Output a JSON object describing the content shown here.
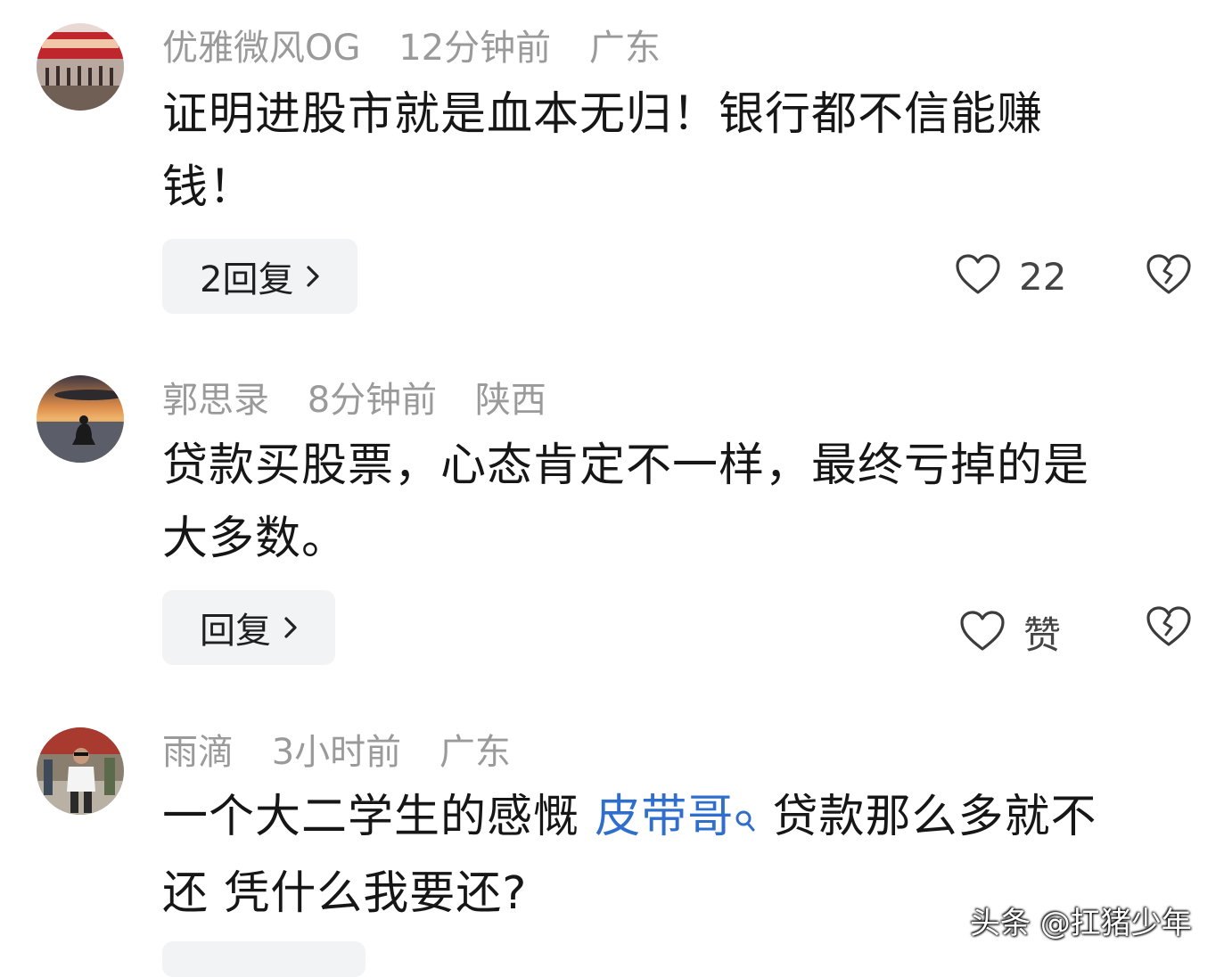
{
  "comments": [
    {
      "user": "优雅微风OG",
      "time": "12分钟前",
      "location": "广东",
      "text_line1": "证明进股市就是血本无归！银行都不信能赚",
      "text_line2": "钱！",
      "reply_label": "2回复",
      "like_count": "22"
    },
    {
      "user": "郭思录",
      "time": "8分钟前",
      "location": "陕西",
      "text_line1": "贷款买股票，心态肯定不一样，最终亏掉的是",
      "text_line2": "大多数。",
      "reply_label": "回复",
      "like_count": "赞"
    },
    {
      "user": "雨滴",
      "time": "3小时前",
      "location": "广东",
      "text_before": "一个大二学生的感慨 ",
      "mention": "皮带哥",
      "text_after": " 贷款那么多就不",
      "text_line2": "还 凭什么我要还?"
    }
  ],
  "watermark": "头条 @扛猪少年",
  "colors": {
    "meta": "#9a9a9a",
    "text": "#161616",
    "mention": "#2f6ecb",
    "reply_bg": "#f2f3f5"
  }
}
